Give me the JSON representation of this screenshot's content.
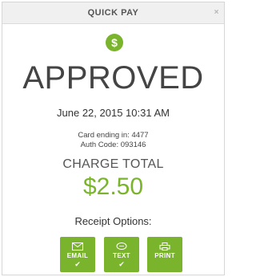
{
  "header": {
    "title": "QUICK PAY",
    "close_glyph": "×"
  },
  "status": {
    "icon": "dollar-icon",
    "icon_glyph": "$",
    "title": "APPROVED"
  },
  "transaction": {
    "datetime": "June 22, 2015 10:31 AM",
    "card_line": "Card ending in: 4477",
    "auth_line": "Auth Code: 093146"
  },
  "charge": {
    "label": "CHARGE TOTAL",
    "amount": "$2.50"
  },
  "receipt": {
    "label": "Receipt Options:",
    "buttons": [
      {
        "label": "EMAIL",
        "icon": "envelope-icon",
        "checked": true,
        "check_glyph": "✔"
      },
      {
        "label": "TEXT",
        "icon": "chat-bubble-icon",
        "checked": true,
        "check_glyph": "✔"
      },
      {
        "label": "PRINT",
        "icon": "printer-icon",
        "checked": false
      }
    ]
  },
  "colors": {
    "accent": "#7ab42c",
    "header_bg": "#f0f0f0",
    "text": "#3a3a3a"
  }
}
